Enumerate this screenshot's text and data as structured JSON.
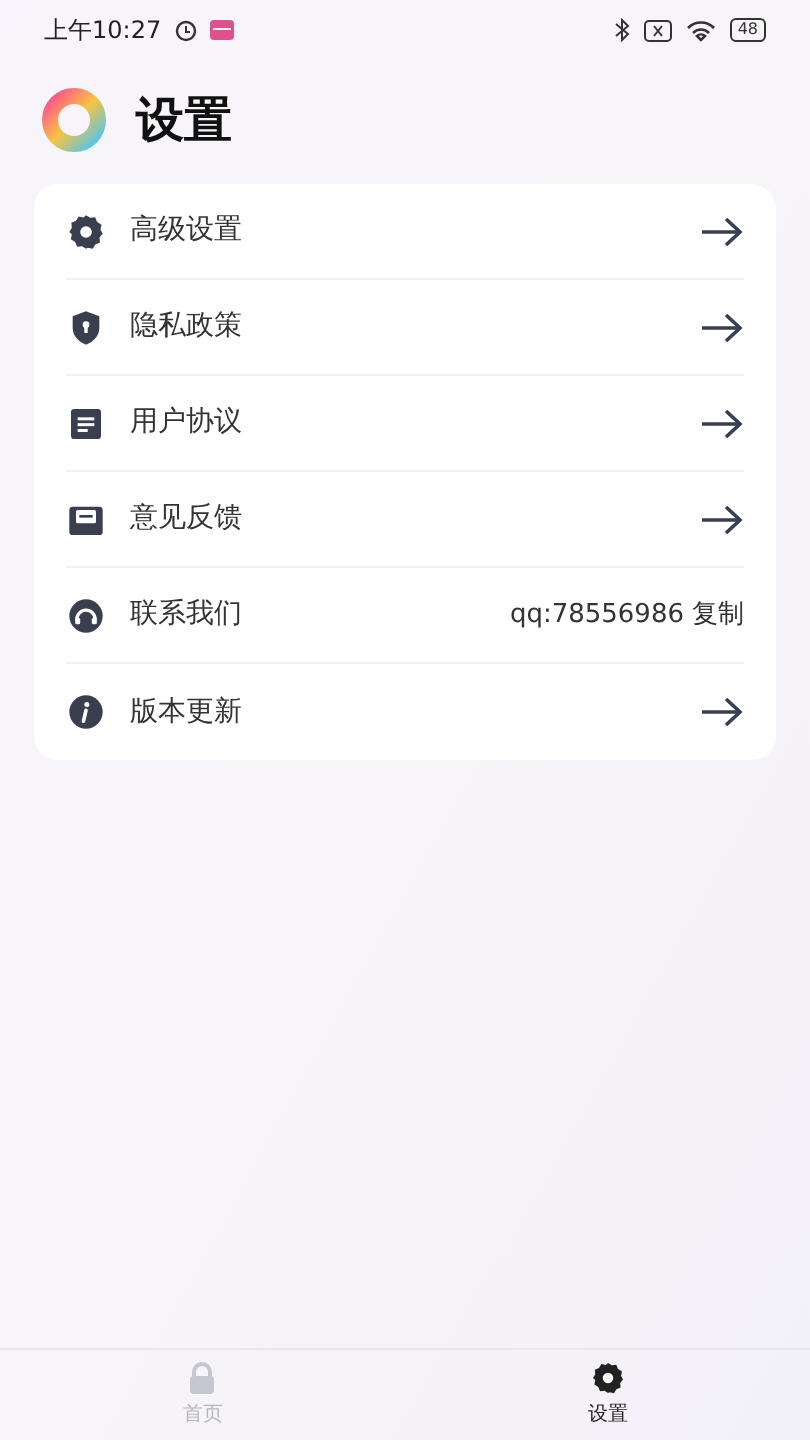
{
  "status_bar": {
    "time": "上午10:27",
    "battery": "48"
  },
  "title": "设置",
  "items": [
    {
      "kind": "arrow",
      "label": "高级设置"
    },
    {
      "kind": "arrow",
      "label": "隐私政策"
    },
    {
      "kind": "arrow",
      "label": "用户协议"
    },
    {
      "kind": "arrow",
      "label": "意见反馈"
    },
    {
      "kind": "contact",
      "label": "联系我们",
      "value": "qq:78556986",
      "action": "复制"
    },
    {
      "kind": "arrow",
      "label": "版本更新"
    }
  ],
  "tabs": [
    {
      "label": "首页",
      "selected": false
    },
    {
      "label": "设置",
      "selected": true
    }
  ]
}
